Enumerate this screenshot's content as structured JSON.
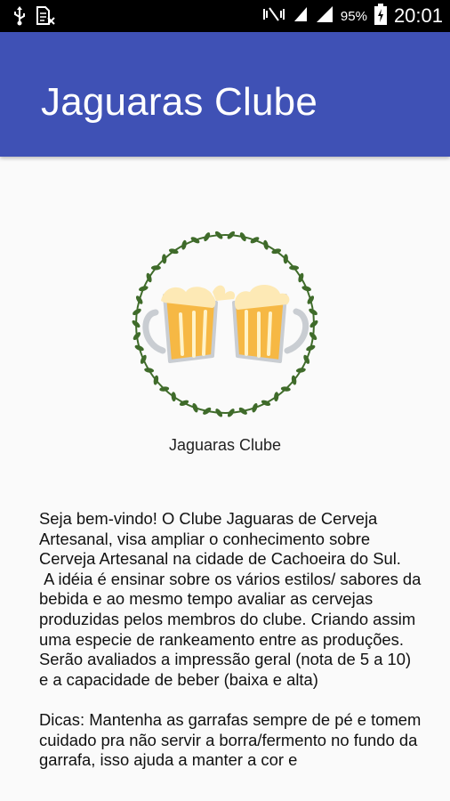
{
  "status_bar": {
    "battery_percent": "95%",
    "time": "20:01",
    "icons": [
      "usb-icon",
      "sim-icon",
      "mute-icon",
      "wifi-icon",
      "signal-icon",
      "battery-charging-icon"
    ]
  },
  "app_bar": {
    "title": "Jaguaras Clube",
    "color": "#3f51b5"
  },
  "logo": {
    "icon": "beer-toast-wreath-icon",
    "caption": "Jaguaras Clube"
  },
  "content": {
    "welcome_text": "Seja bem-vindo! O Clube Jaguaras de Cerveja Artesanal, visa ampliar o conhecimento sobre Cerveja Artesanal na cidade de Cachoeira do Sul.\n A idéia é ensinar sobre os vários estilos/ sabores da bebida e ao mesmo tempo avaliar as cervejas produzidas pelos membros do clube. Criando assim uma especie de rankeamento entre as produções. Serão avaliados a impressão geral (nota de 5 a 10) e a capacidade de beber (baixa e alta)\n\nDicas: Mantenha as garrafas sempre de pé e tomem cuidado pra não servir a borra/fermento no fundo da garrafa, isso ajuda a manter a cor e"
  }
}
